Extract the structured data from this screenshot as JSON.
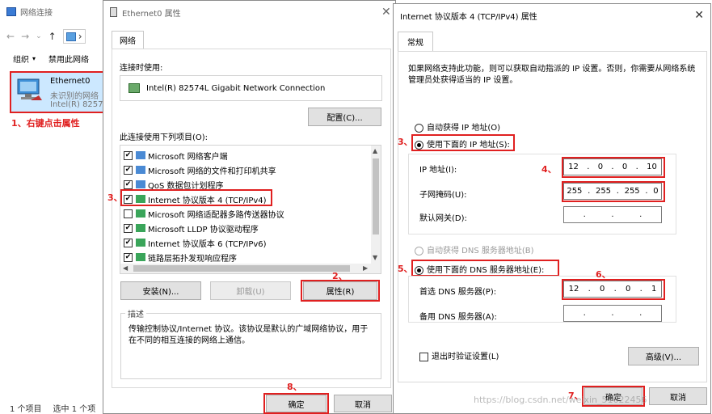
{
  "explorer": {
    "title": "网络连接",
    "nav": [
      "←",
      "→",
      "⌄",
      "↑",
      "›"
    ],
    "toolbar": [
      "组织",
      "▾",
      "禁用此网络"
    ],
    "item": {
      "name": "Ethernet0",
      "status": "未识别的网络",
      "adapter": "Intel(R) 8257"
    },
    "status_left": "1 个项目",
    "status_right": "选中 1 个项"
  },
  "props": {
    "title": "Ethernet0 属性",
    "tab": "网络",
    "connect_label": "连接时使用:",
    "adapter_name": "Intel(R) 82574L Gigabit Network Connection",
    "configure_button": "配置(C)...",
    "items_label": "此连接使用下列项目(O):",
    "items": [
      {
        "label": "Microsoft 网络客户端",
        "checked": "✔"
      },
      {
        "label": "Microsoft 网络的文件和打印机共享",
        "checked": "✔"
      },
      {
        "label": "QoS 数据包计划程序",
        "checked": "✔"
      },
      {
        "label": "Internet 协议版本 4 (TCP/IPv4)",
        "checked": "✔"
      },
      {
        "label": "Microsoft 网络适配器多路传送器协议",
        "checked": ""
      },
      {
        "label": "Microsoft LLDP 协议驱动程序",
        "checked": "✔"
      },
      {
        "label": "Internet 协议版本 6 (TCP/IPv6)",
        "checked": "✔"
      },
      {
        "label": "链路层拓扑发现响应程序",
        "checked": "✔"
      }
    ],
    "install_button": "安装(N)...",
    "uninstall_button": "卸载(U)",
    "properties_button": "属性(R)",
    "description_label": "描述",
    "description_text": "传输控制协议/Internet 协议。该协议是默认的广域网络协议，用于在不同的相互连接的网络上通信。",
    "ok_button": "确定",
    "cancel_button": "取消"
  },
  "ipv4": {
    "title": "Internet 协议版本 4 (TCP/IPv4) 属性",
    "close": "✕",
    "tab": "常规",
    "intro": "如果网络支持此功能，则可以获取自动指派的 IP 设置。否则，你需要从网络系统管理员处获得适当的 IP 设置。",
    "auto_ip": "自动获得 IP 地址(O)",
    "manual_ip": "使用下面的 IP 地址(S):",
    "ip_label": "IP 地址(I):",
    "ip_value": [
      "12",
      "0",
      "0",
      "10"
    ],
    "mask_label": "子网掩码(U):",
    "mask_value": [
      "255",
      "255",
      "255",
      "0"
    ],
    "gateway_label": "默认网关(D):",
    "gateway_value": [
      "",
      "",
      "",
      ""
    ],
    "auto_dns": "自动获得 DNS 服务器地址(B)",
    "manual_dns": "使用下面的 DNS 服务器地址(E):",
    "dns1_label": "首选 DNS 服务器(P):",
    "dns1_value": [
      "12",
      "0",
      "0",
      "1"
    ],
    "dns2_label": "备用 DNS 服务器(A):",
    "dns2_value": [
      "",
      "",
      "",
      ""
    ],
    "validate_label": "退出时验证设置(L)",
    "advanced_button": "高级(V)...",
    "ok_button": "确定",
    "cancel_button": "取消"
  },
  "annotations": {
    "a1": "1、右键点击属性",
    "a2": "2、",
    "a3": "3、",
    "a3b": "3、",
    "a4": "4、",
    "a5": "5、",
    "a6": "6、",
    "a7": "7、",
    "a8": "8、"
  },
  "watermark": "https://blog.csdn.net/weixin_51622456",
  "colors": {
    "annotation": "#e02020",
    "selection": "#cce8ff",
    "button": "#e1e1e1"
  }
}
